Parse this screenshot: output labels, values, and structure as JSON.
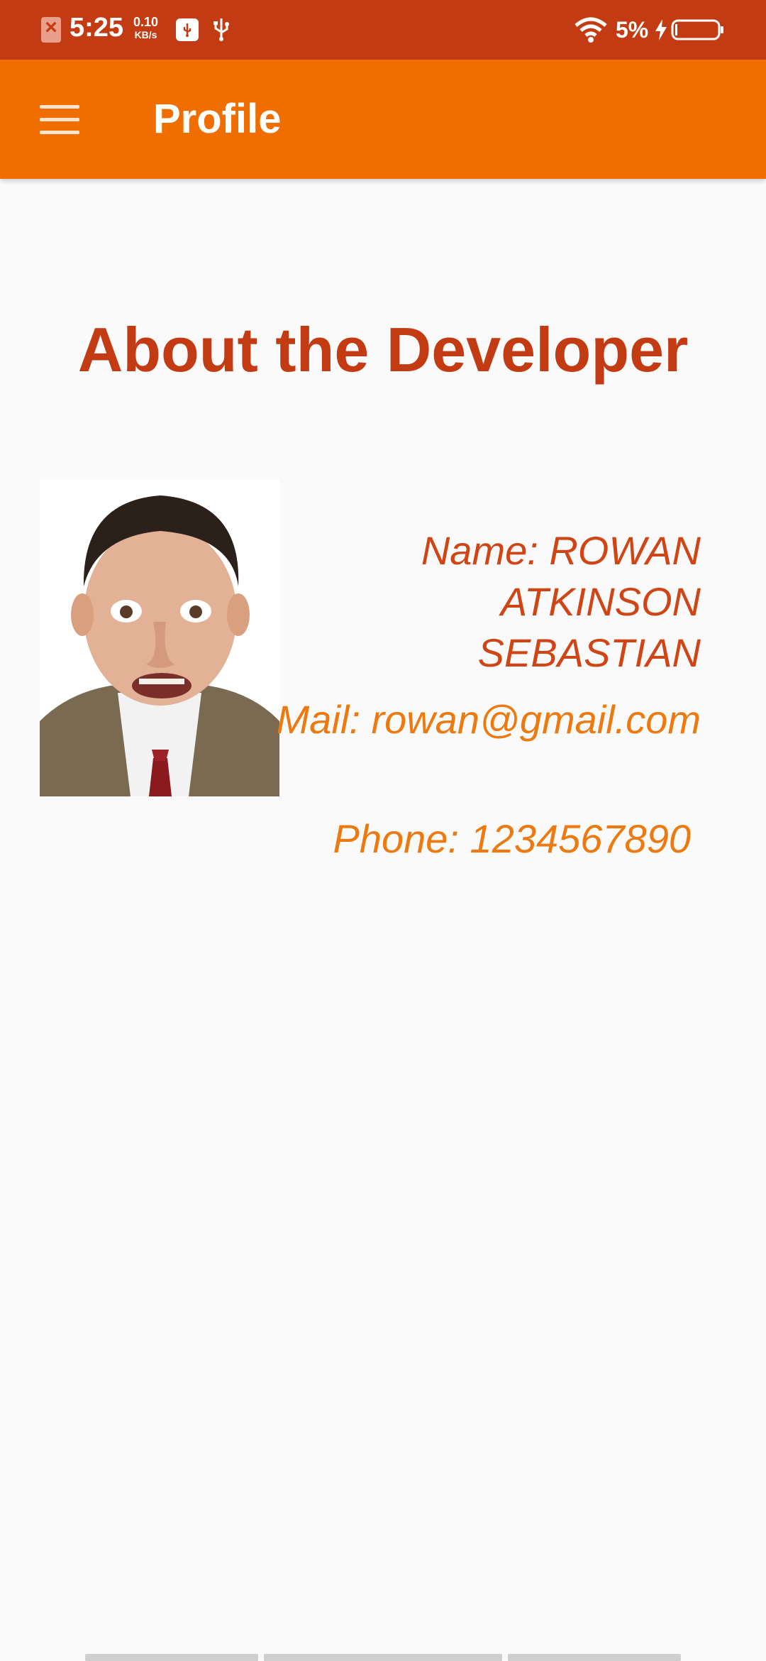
{
  "status_bar": {
    "time": "5:25",
    "speed_value": "0.10",
    "speed_unit": "KB/s",
    "battery_percent": "5%",
    "icons": [
      "sim-error-icon",
      "usb-debug-icon",
      "usb-icon",
      "wifi-icon",
      "charging-bolt-icon",
      "battery-icon"
    ]
  },
  "app_bar": {
    "menu_icon": "hamburger-menu-icon",
    "title": "Profile"
  },
  "content": {
    "heading": "About the Developer",
    "photo_alt": "developer-photo",
    "name": "Name: ROWAN ATKINSON SEBASTIAN",
    "mail": "Mail: rowan@gmail.com",
    "phone": "Phone: 1234567890"
  },
  "colors": {
    "status_bar_bg": "#c23b12",
    "app_bar_bg": "#f06e00",
    "heading": "#c23b12",
    "name_text": "#d04516",
    "contact_text": "#ec7a10",
    "page_bg": "#fafafa"
  }
}
